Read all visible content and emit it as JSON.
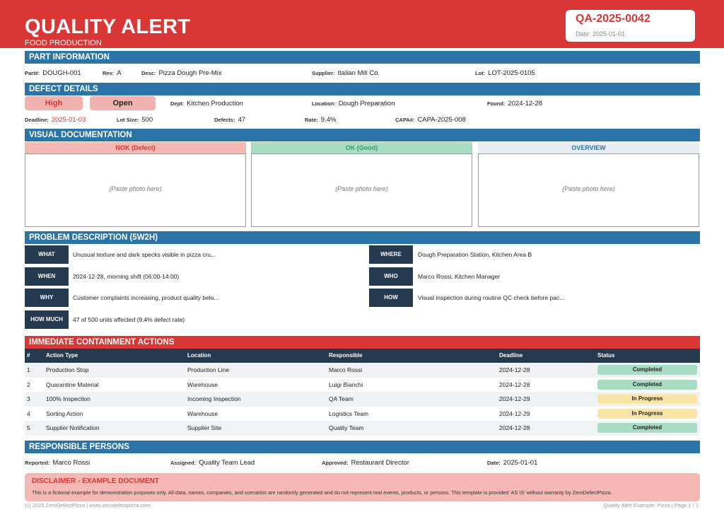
{
  "header": {
    "title": "QUALITY ALERT",
    "subtitle": "FOOD PRODUCTION",
    "alert_id": "QA-2025-0042",
    "date": "Date: 2025-01-01"
  },
  "part_info": {
    "section_title": "PART INFORMATION",
    "part_label": "Part#:",
    "part": "DOUGH-001",
    "rev_label": "Rev:",
    "rev": "A",
    "desc_label": "Desc:",
    "desc": "Pizza Dough Pre-Mix",
    "supplier_label": "Supplier:",
    "supplier": "Italian Mill Co.",
    "lot_label": "Lot:",
    "lot": "LOT-2025-0105"
  },
  "defect": {
    "section_title": "DEFECT DETAILS",
    "priority": "High",
    "state": "Open",
    "dept_label": "Dept:",
    "dept": "Kitchen Production",
    "location_label": "Location:",
    "location": "Dough Preparation",
    "found_label": "Found:",
    "found": "2024-12-28",
    "deadline_label": "Deadline:",
    "deadline": "2025-01-03",
    "lot_size_label": "Lot Size:",
    "lot_size": "500",
    "defects_label": "Defects:",
    "defects": "47",
    "rate_label": "Rate:",
    "rate": "9.4%",
    "capa_label": "CAPA#:",
    "capa": "CAPA-2025-008"
  },
  "visual": {
    "section_title": "VISUAL DOCUMENTATION",
    "panels": [
      {
        "label": "NOK (Defect)",
        "placeholder": "(Paste photo here)",
        "bg": "#f5b8b5",
        "color": "#d93636"
      },
      {
        "label": "OK (Good)",
        "placeholder": "(Paste photo here)",
        "bg": "#a8dcc3",
        "color": "#3a9a6a"
      },
      {
        "label": "OVERVIEW",
        "placeholder": "(Paste photo here)",
        "bg": "#e8eef4",
        "color": "#2a74a8"
      }
    ]
  },
  "problem": {
    "section_title": "PROBLEM DESCRIPTION (5W2H)",
    "what_label": "WHAT",
    "what": "Unusual texture and dark specks visible in pizza cru...",
    "where_label": "WHERE",
    "where": "Dough Preparation Station, Kitchen Area B",
    "when_label": "WHEN",
    "when": "2024-12-28, morning shift (06:00-14:00)",
    "who_label": "WHO",
    "who": "Marco Rossi, Kitchen Manager",
    "why_label": "WHY",
    "why": "Customer complaints increasing, product quality belo...",
    "how_label": "HOW",
    "how": "Visual inspection during routine QC check before pac...",
    "howmuch_label": "HOW MUCH",
    "howmuch": "47 of 500 units affected (9.4% defect rate)"
  },
  "containment": {
    "section_title": "IMMEDIATE CONTAINMENT ACTIONS",
    "headers": [
      "#",
      "Action Type",
      "Location",
      "Responsible",
      "Deadline",
      "Status"
    ],
    "rows": [
      [
        "1",
        "Production Stop",
        "Production Line",
        "Marco Rossi",
        "2024-12-28",
        "Completed"
      ],
      [
        "2",
        "Quarantine Material",
        "Warehouse",
        "Luigi Bianchi",
        "2024-12-28",
        "Completed"
      ],
      [
        "3",
        "100% Inspection",
        "Incoming Inspection",
        "QA Team",
        "2024-12-29",
        "In Progress"
      ],
      [
        "4",
        "Sorting Action",
        "Warehouse",
        "Logistics Team",
        "2024-12-29",
        "In Progress"
      ],
      [
        "5",
        "Supplier Notification",
        "Supplier Site",
        "Quality Team",
        "2024-12-28",
        "Completed"
      ]
    ],
    "status_colors": {
      "Completed": "#a8dcc3",
      "In Progress": "#fbe5a6"
    }
  },
  "responsible": {
    "section_title": "RESPONSIBLE PERSONS",
    "reported_label": "Reported:",
    "reported": "Marco Rossi",
    "assigned_label": "Assigned:",
    "assigned": "Quality Team Lead",
    "approved_label": "Approved:",
    "approved": "Restaurant Director",
    "date_label": "Date:",
    "date": "2025-01-01"
  },
  "disclaimer": {
    "title": "DISCLAIMER - EXAMPLE DOCUMENT",
    "text": "This is a fictional example for demonstration purposes only. All data, names, companies, and scenarios are randomly generated and do not represent real events, products, or persons. This template is provided 'AS IS' without warranty by ZeroDefectPizza."
  },
  "footer": {
    "left": "(c) 2025 ZeroDefectPizza | www.zerodefectpizza.com",
    "right": "Quality Alert Example: Pizza | Page 1 / 1"
  }
}
